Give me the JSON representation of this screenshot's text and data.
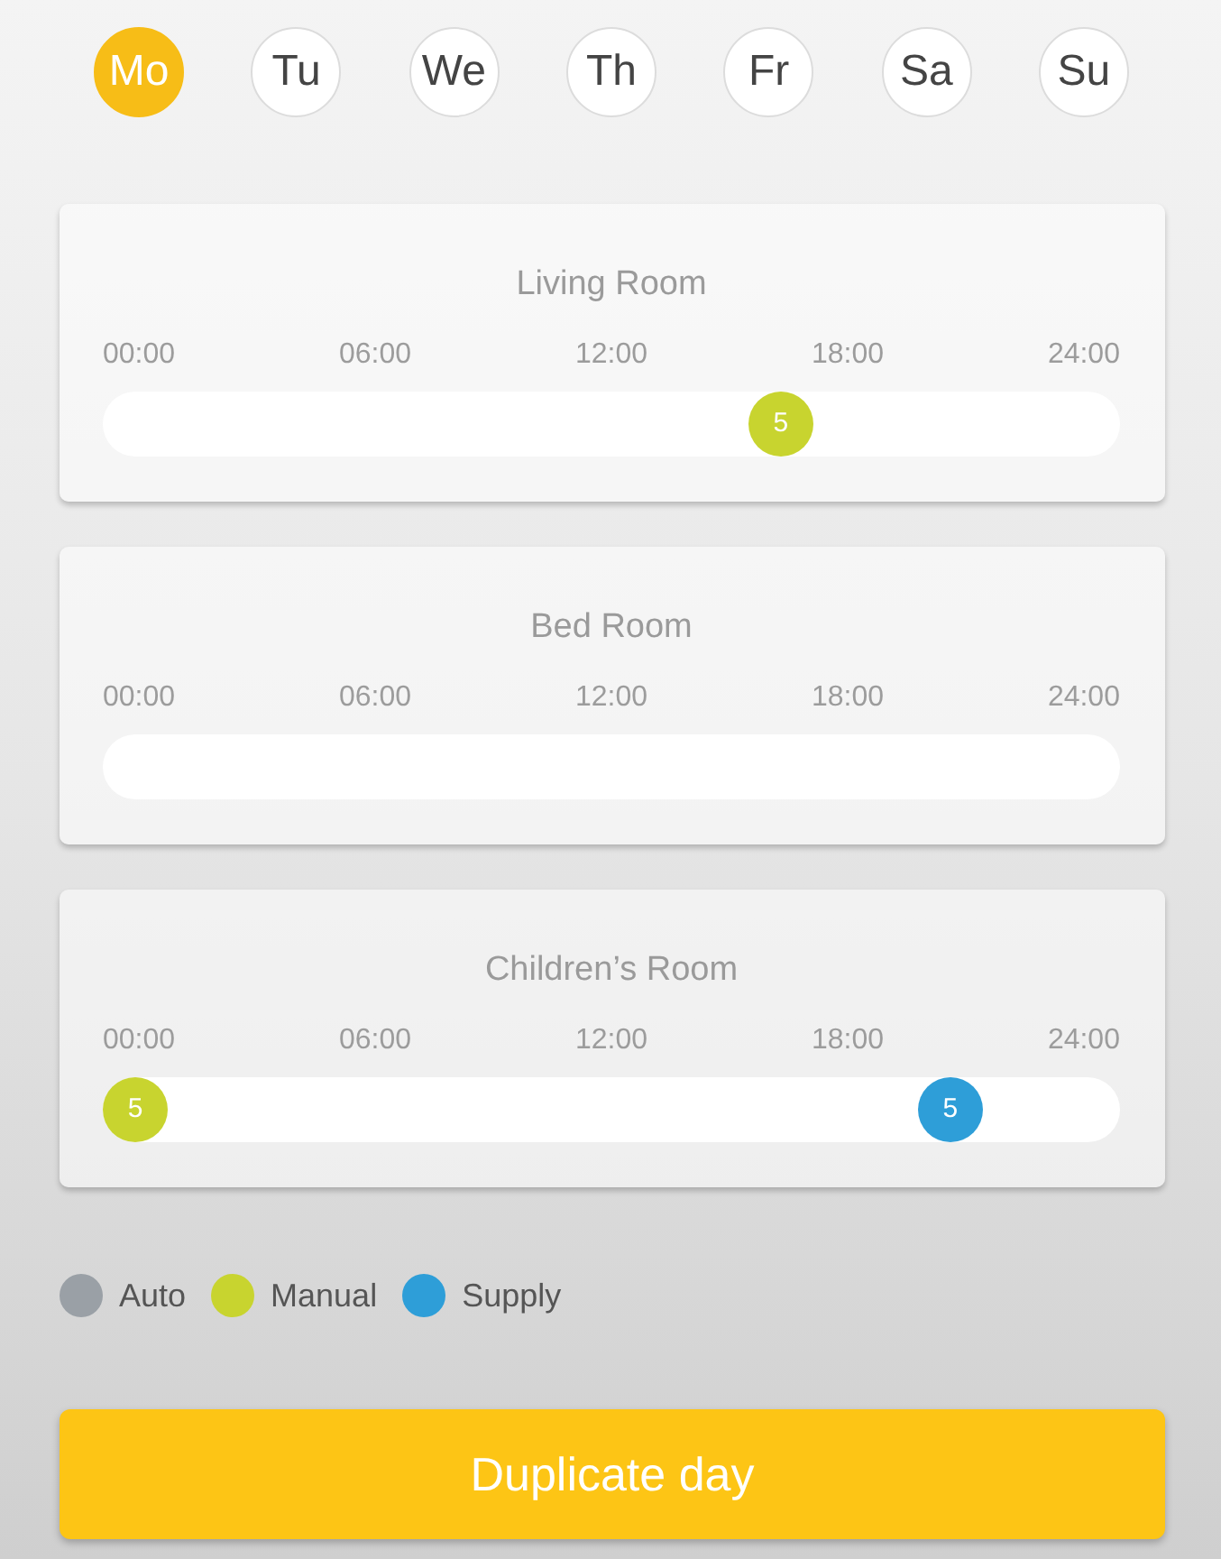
{
  "days": [
    {
      "label": "Mo",
      "selected": true
    },
    {
      "label": "Tu",
      "selected": false
    },
    {
      "label": "We",
      "selected": false
    },
    {
      "label": "Th",
      "selected": false
    },
    {
      "label": "Fr",
      "selected": false
    },
    {
      "label": "Sa",
      "selected": false
    },
    {
      "label": "Su",
      "selected": false
    }
  ],
  "rooms": [
    {
      "title": "Living Room",
      "ticks": [
        "00:00",
        "06:00",
        "12:00",
        "18:00",
        "24:00"
      ],
      "markers": [
        {
          "value": "5",
          "level": 0.678,
          "color": "#c8d42f"
        }
      ]
    },
    {
      "title": "Bed Room",
      "ticks": [
        "00:00",
        "06:00",
        "12:00",
        "18:00",
        "24:00"
      ]
    },
    {
      "title": "Children’s Room",
      "ticks": [
        "00:00",
        "06:00",
        "12:00",
        "18:00",
        "24:00"
      ],
      "markers": [
        {
          "value": "5",
          "level": 0,
          "color": "#c8d42f"
        },
        {
          "value": "5",
          "level": 0.856,
          "color": "#2e9ed8"
        }
      ]
    }
  ],
  "legend": [
    {
      "label": "Auto",
      "color": "#9aa0a6"
    },
    {
      "label": "Manual",
      "color": "#c8d42f"
    },
    {
      "label": "Supply",
      "color": "#2e9ed8"
    }
  ],
  "button": {
    "label": "Duplicate day"
  }
}
